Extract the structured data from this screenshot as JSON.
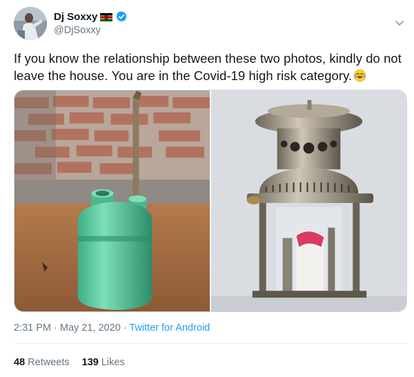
{
  "user": {
    "display_name": "Dj Soxxy",
    "handle": "@DjSoxxy",
    "flag_icon": "kenya-flag-icon",
    "verified_icon": "verified-badge-icon",
    "accent": "#1da1f2"
  },
  "tweet": {
    "text": "If you know the relationship between these two photos, kindly do not leave the house. You are in the Covid-19 high risk category.",
    "emoji": "face-with-tears-of-joy-icon"
  },
  "meta": {
    "time": "2:31 PM",
    "sep1": " · ",
    "date": "May 21, 2020",
    "sep2": " · ",
    "source": "Twitter for Android"
  },
  "stats": {
    "retweets_count": "48",
    "retweets_label": "Retweets",
    "likes_count": "139",
    "likes_label": "Likes"
  }
}
